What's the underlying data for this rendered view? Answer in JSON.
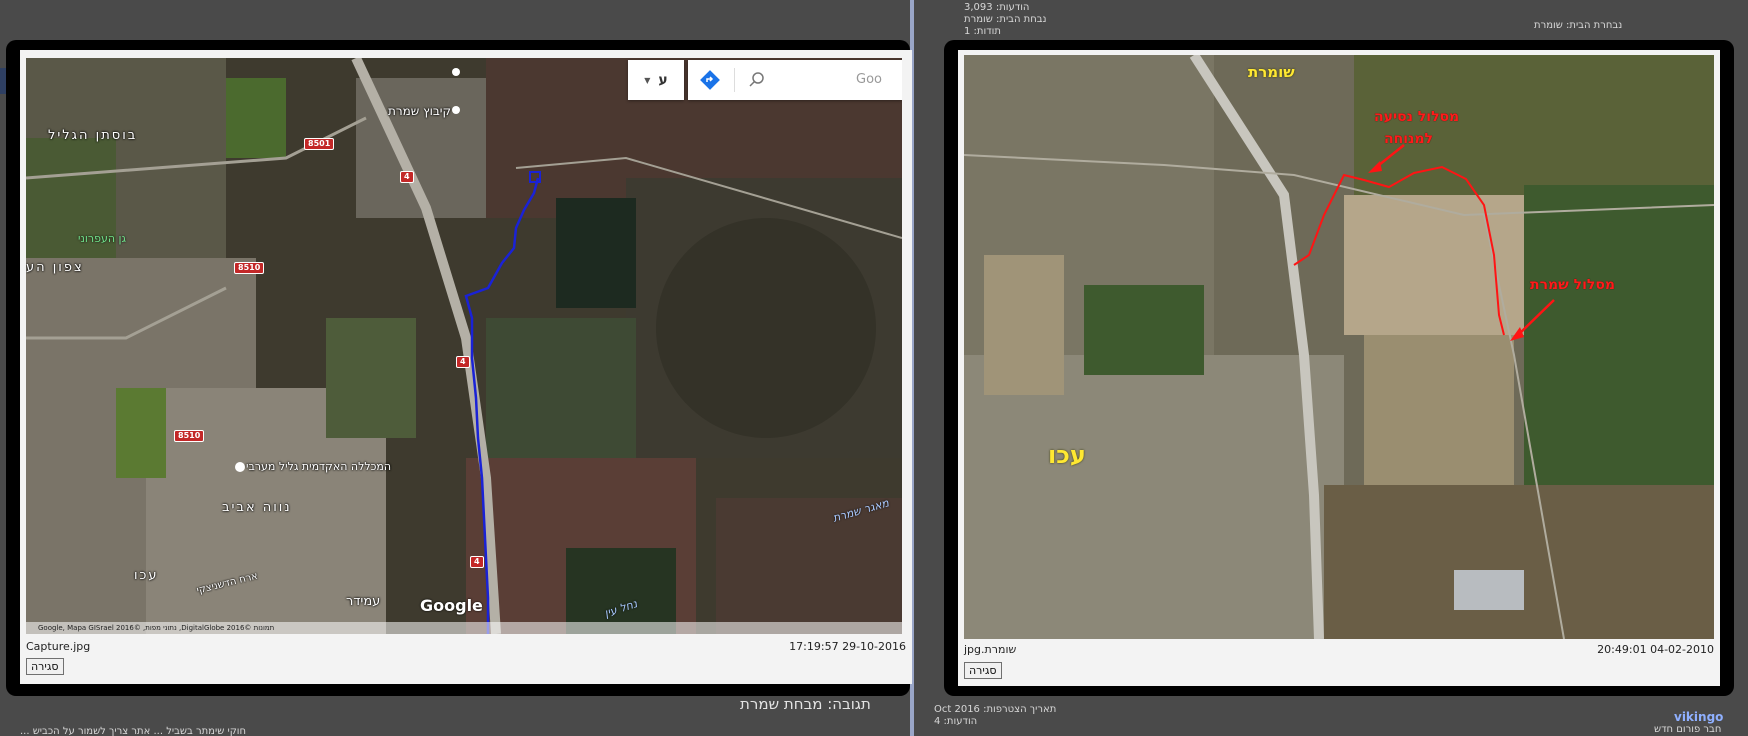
{
  "background": {
    "left_forum_lines": [
      "תגובה: מבחת שמרת",
      "חוקי שימתר בשביל ... אתר צריך לשמור על הכביש ..."
    ],
    "right_forum_lines": [
      "הודעות: 3,093",
      "נבחת הבית: שומרת",
      "תודות: 1",
      "נבחרת הבית: שומרת",
      "תאריך הצטרפות: Oct 2016",
      "הודעות: 4",
      "vikingo",
      "חבר פורום חדש"
    ],
    "reply_title": "תגובה: מבחת שמרת"
  },
  "left_viewer": {
    "caption_file": "Capture.jpg",
    "caption_date": "17:19:57 29-10-2016",
    "close_label": "סגירה",
    "map": {
      "search_placeholder": "Goo",
      "language_button": "ע",
      "logo_text": "Google",
      "attribution": "Google, Mapa GISrael 2016© ,נתוני מפות ,DigitalGlobe 2016© תמונות",
      "labels": {
        "kibbutz_shamrat": "קיבוץ שמרת",
        "bustan_hagalil": "בוסתן הגליל",
        "gan_haefroni": "גן העפרוני",
        "tzafon_hair": "צפון הע",
        "college": "המכללה האקדמית גליל מערבי",
        "neve_aviv": "נווה אביב",
        "akko": "עכו",
        "ariha_dr": "ארח הדשניצקי",
        "amida": "עמידר",
        "maagar_shamrat": "מאגר שמרת",
        "nahal_ein": "נחל עין"
      },
      "road_shields": [
        "8501",
        "4",
        "8510",
        "4",
        "8510",
        "4"
      ]
    }
  },
  "right_viewer": {
    "caption_file": "jpg.שומרת",
    "caption_date": "20:49:01 04-02-2010",
    "close_label": "סגירה",
    "annotations": {
      "shomrat": "שומרת",
      "access_route_line1": "מסלול נסיעה",
      "access_route_line2": "למנוחה",
      "shomrat_route": "מסלול שמרת",
      "akko": "עכו"
    }
  },
  "colors": {
    "route_blue": "#1a22d6",
    "route_red": "#ff1414",
    "label_yellow": "#ffe832",
    "lightbox_bg": "#000000"
  }
}
